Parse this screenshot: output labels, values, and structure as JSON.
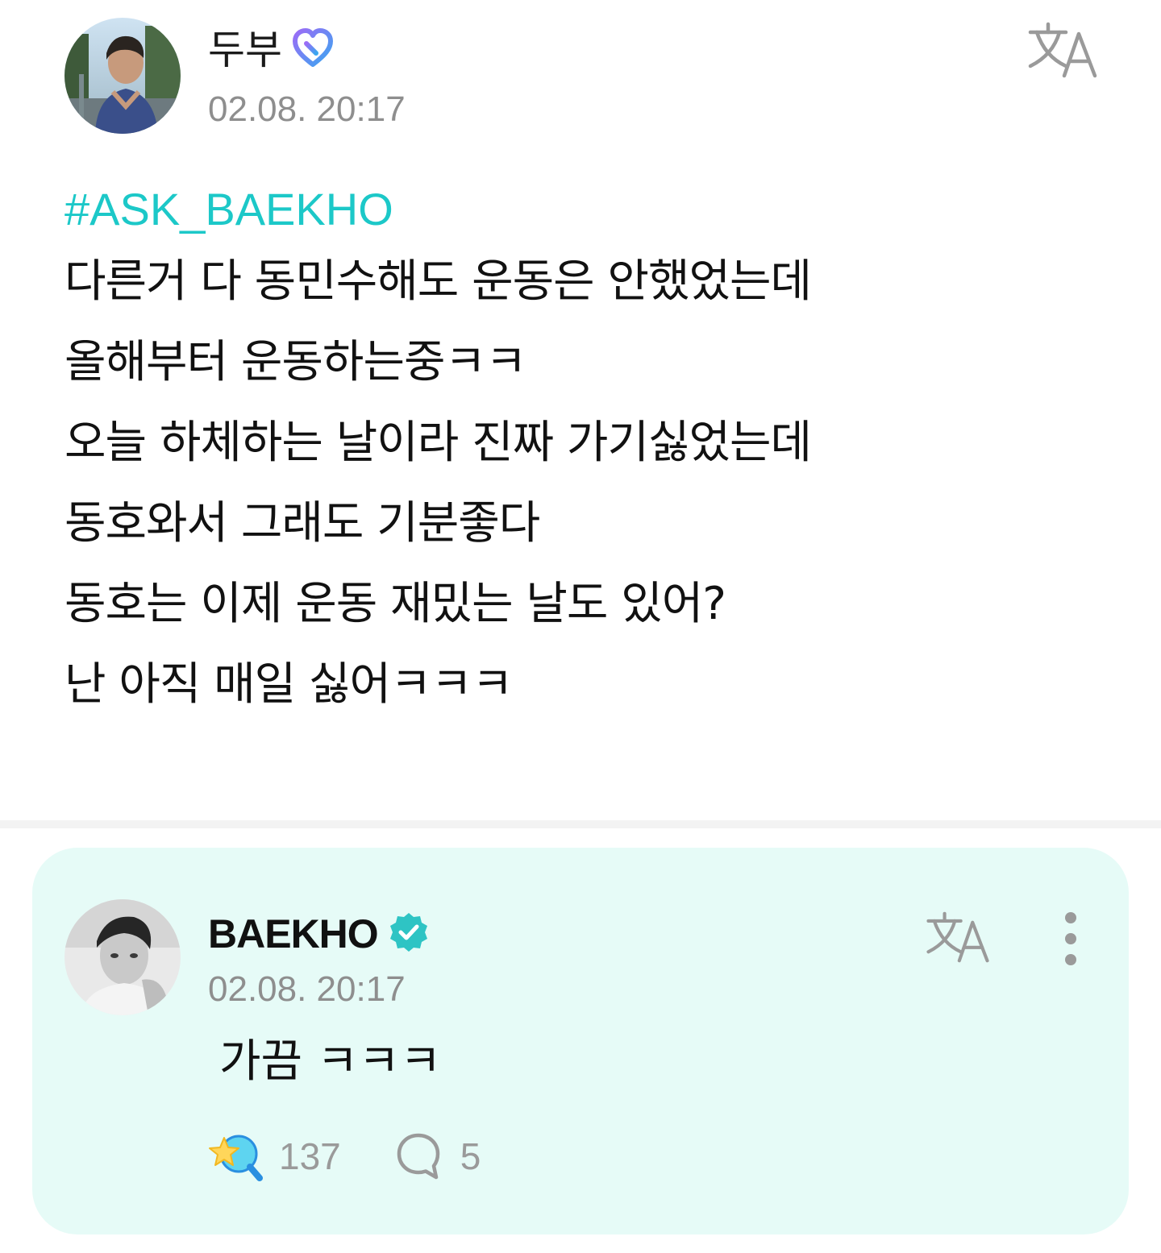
{
  "post": {
    "author": {
      "name": "두부",
      "badge_icon": "fan-heart-badge-icon",
      "badge_color": "#7b6cf6"
    },
    "timestamp": "02.08. 20:17",
    "translate_icon": "translate-icon",
    "hashtag": "#ASK_BAEKHO",
    "hashtag_color": "#1cc8c8",
    "lines": [
      "다른거 다 동민수해도 운동은 안했었는데",
      "올해부터 운동하는중ㅋㅋ",
      "오늘 하체하는 날이라 진짜 가기싫었는데",
      "동호와서 그래도 기분좋다",
      "동호는 이제 운동 재밌는 날도 있어?",
      "난 아직 매일 싫어ㅋㅋㅋ"
    ]
  },
  "reply": {
    "author": {
      "name": "BAEKHO",
      "badge_icon": "verified-badge-icon",
      "badge_color": "#2ec4c4"
    },
    "timestamp": "02.08. 20:17",
    "translate_icon": "translate-icon",
    "more_icon": "more-vertical-icon",
    "text": "가끔 ㅋㅋㅋ",
    "background_color": "#e6fbf7",
    "reactions": {
      "like_icon": "star-wand-like-icon",
      "like_count": "137",
      "comment_icon": "speech-bubble-icon",
      "comment_count": "5"
    }
  }
}
